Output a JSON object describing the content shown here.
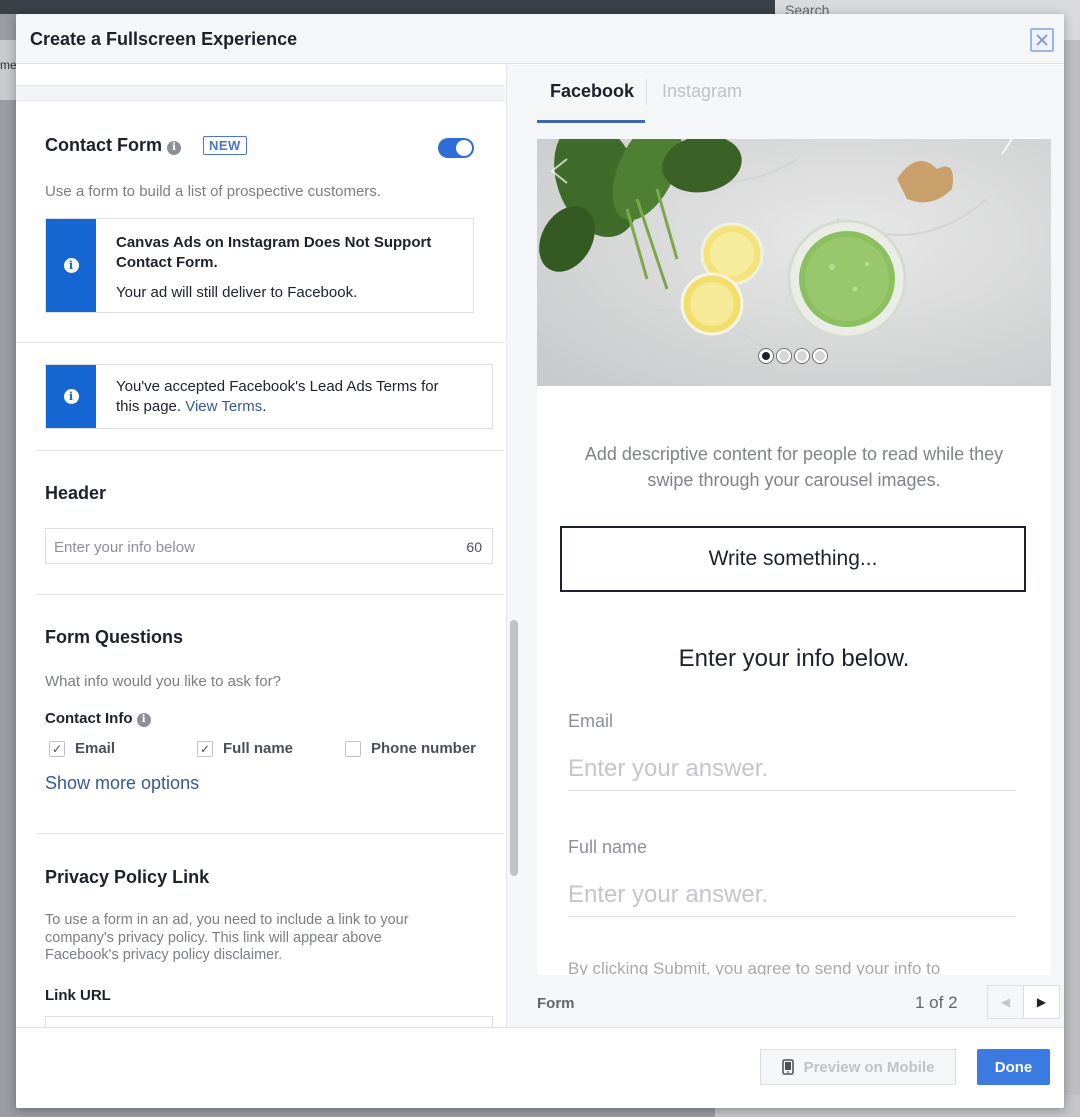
{
  "background": {
    "search_label": "Search",
    "left_fragment": "me"
  },
  "modal": {
    "title": "Create a Fullscreen Experience"
  },
  "contact_form": {
    "title": "Contact Form",
    "badge": "NEW",
    "enabled": true,
    "description": "Use a form to build a list of prospective customers.",
    "notice_title": "Canvas Ads on Instagram Does Not Support Contact Form.",
    "notice_body": "Your ad will still deliver to Facebook."
  },
  "terms_notice": {
    "text_line1": "You've accepted Facebook's Lead Ads Terms for",
    "text_line2_prefix": "this page.",
    "link": "View Terms",
    "text_suffix": "."
  },
  "header_section": {
    "title": "Header",
    "placeholder": "Enter your info below",
    "char_count": "60"
  },
  "form_questions": {
    "title": "Form Questions",
    "description": "What info would you like to ask for?",
    "contact_info_label": "Contact Info",
    "options": [
      {
        "label": "Email",
        "checked": true
      },
      {
        "label": "Full name",
        "checked": true
      },
      {
        "label": "Phone number",
        "checked": false
      }
    ],
    "show_more": "Show more options"
  },
  "privacy": {
    "title": "Privacy Policy Link",
    "description_line1": "To use a form in an ad, you need to include a link to your",
    "description_line2": "company's privacy policy. This link will appear above",
    "description_line3": "Facebook's privacy policy disclaimer.",
    "link_url_label": "Link URL"
  },
  "preview": {
    "tabs": [
      {
        "label": "Facebook",
        "active": true
      },
      {
        "label": "Instagram",
        "active": false
      }
    ],
    "carousel_dots": 4,
    "carousel_active_index": 0,
    "description_line1": "Add descriptive content for people to read while they",
    "description_line2": "swipe through your carousel images.",
    "write_something": "Write something...",
    "enter_info": "Enter your info below.",
    "fields": [
      {
        "label": "Email",
        "placeholder": "Enter your answer."
      },
      {
        "label": "Full name",
        "placeholder": "Enter your answer."
      }
    ],
    "disclaimer": "By clicking Submit, you agree to send your info to",
    "footer_label": "Form",
    "page_indicator": "1 of 2"
  },
  "footer": {
    "preview_button": "Preview on Mobile",
    "done_button": "Done"
  },
  "colors": {
    "accent_blue": "#1565d3",
    "toggle_on": "#2d6ed6",
    "done_blue": "#3b7ae0",
    "link_blue": "#365899"
  }
}
